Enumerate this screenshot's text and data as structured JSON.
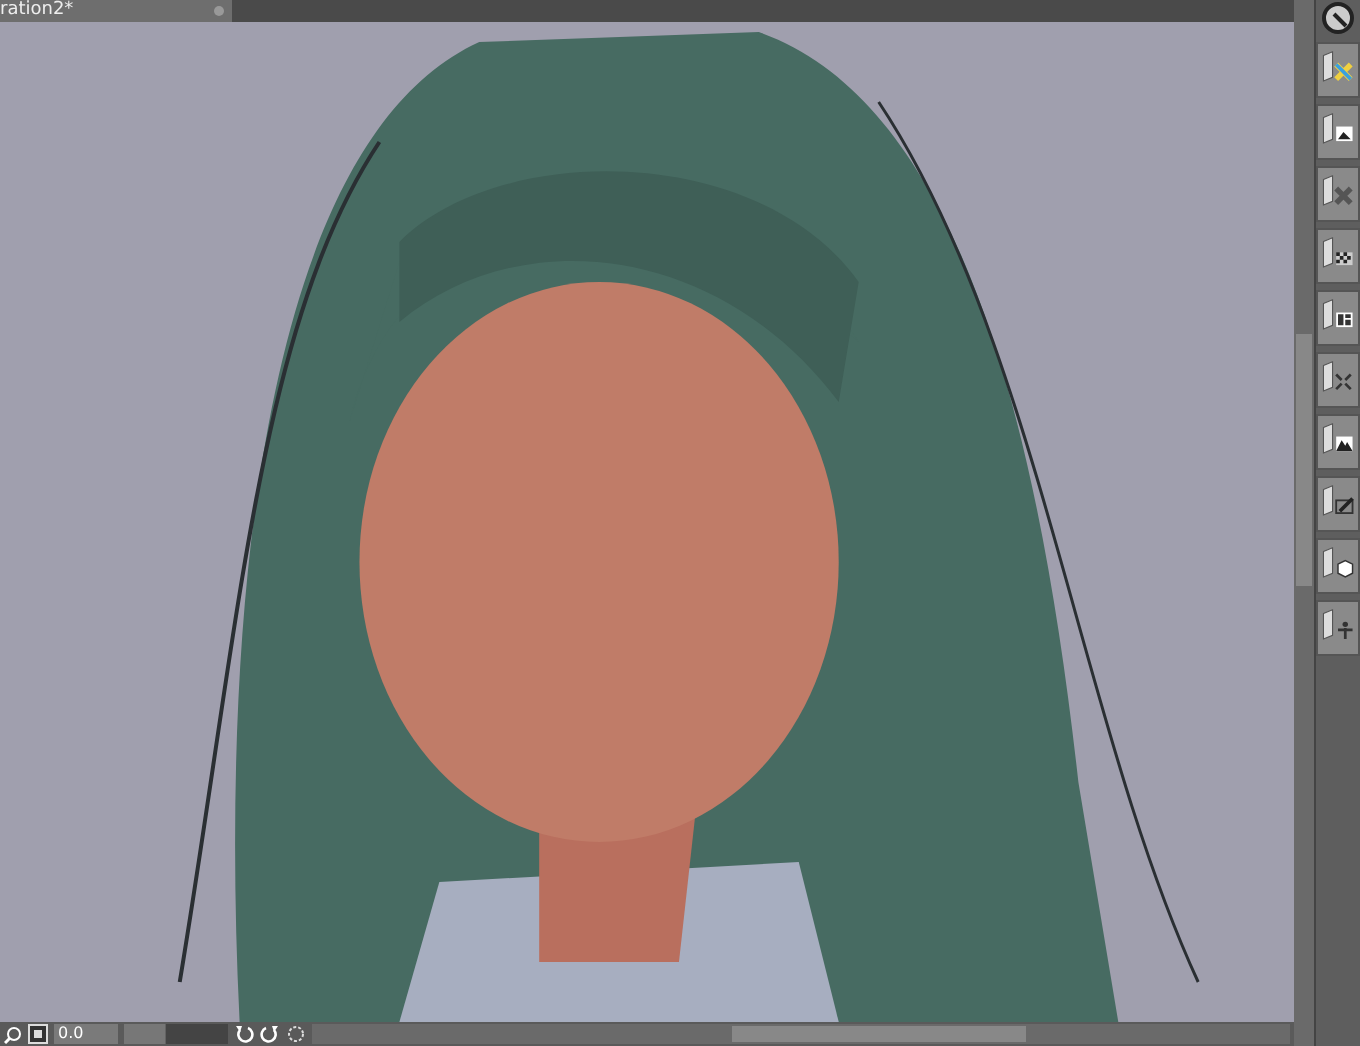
{
  "document_tab": {
    "title": "ration2*"
  },
  "status_bar": {
    "rotation": "0.0",
    "rotation_slider": {
      "level": 0.4
    }
  }
}
